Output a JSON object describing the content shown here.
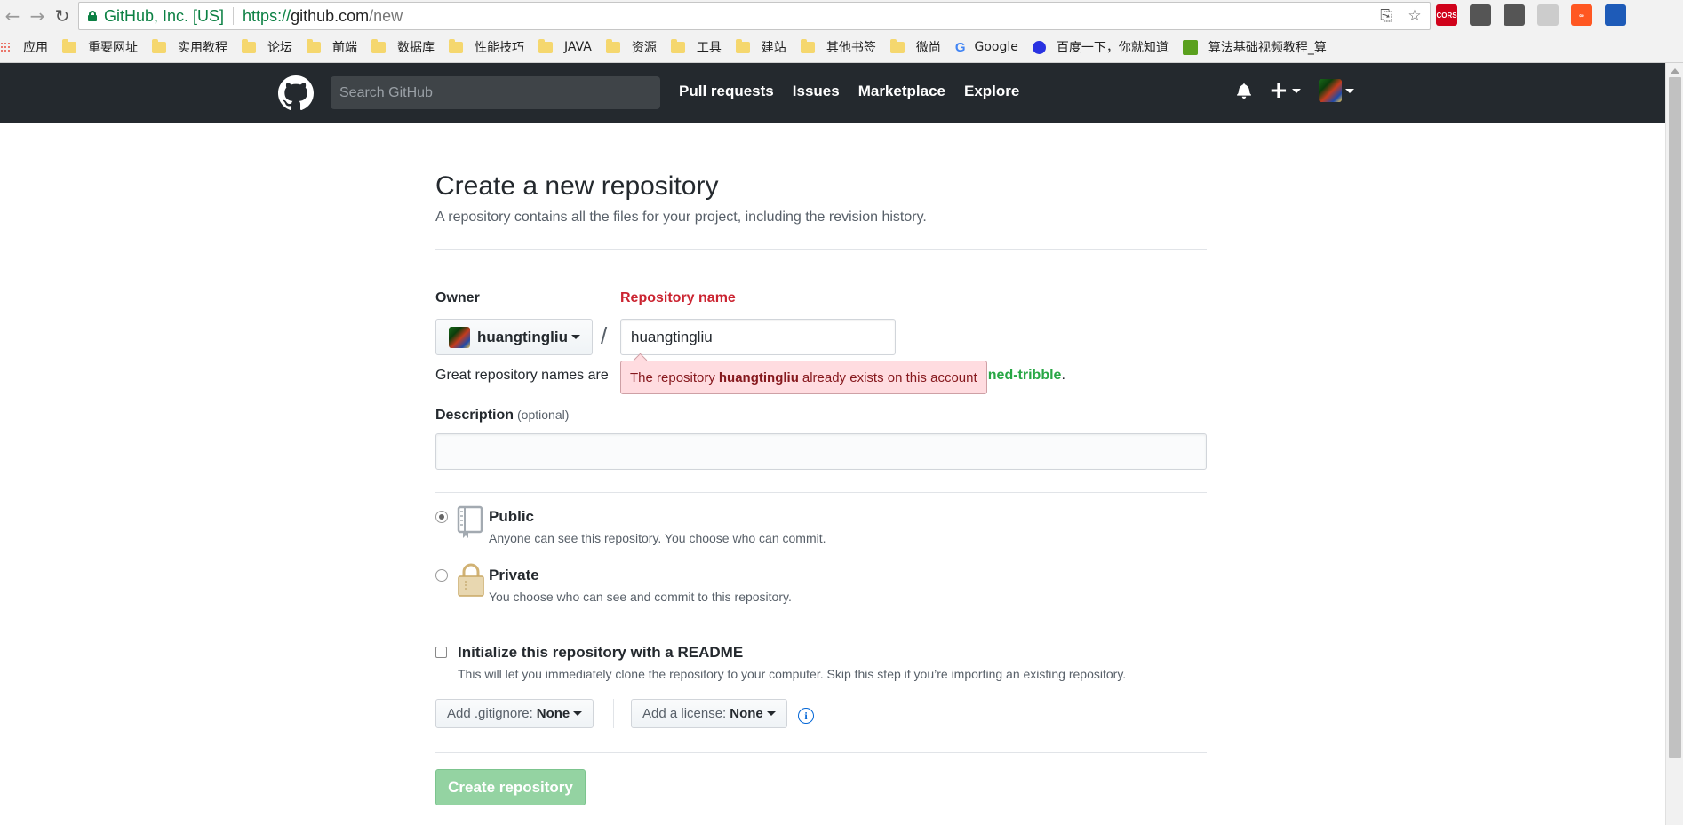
{
  "browser": {
    "site_identity": "GitHub, Inc. [US]",
    "url_secure": "https://",
    "url_host": "github.com",
    "url_path": "/new",
    "bookmarks": [
      "应用",
      "重要网址",
      "实用教程",
      "论坛",
      "前端",
      "数据库",
      "性能技巧",
      "JAVA",
      "资源",
      "工具",
      "建站",
      "其他书签",
      "微尚",
      "Google",
      "百度一下，你就知道",
      "算法基础视频教程_算"
    ],
    "extensions": [
      {
        "name": "cors-icon",
        "label": "CORS",
        "color": "#d0021b"
      },
      {
        "name": "evernote-icon",
        "label": "",
        "color": "#555555"
      },
      {
        "name": "translate-icon",
        "label": "",
        "color": "#555555"
      },
      {
        "name": "shield-icon",
        "label": "",
        "color": "#cccccc"
      },
      {
        "name": "infinity-icon",
        "label": "∞",
        "color": "#ff5722"
      },
      {
        "name": "calendar-icon",
        "label": "",
        "color": "#1e5bb8"
      }
    ]
  },
  "github": {
    "search_placeholder": "Search GitHub",
    "nav": [
      "Pull requests",
      "Issues",
      "Marketplace",
      "Explore"
    ]
  },
  "form": {
    "title": "Create a new repository",
    "subtitle": "A repository contains all the files for your project, including the revision history.",
    "owner_label": "Owner",
    "owner_name": "huangtingliu",
    "repo_label": "Repository name",
    "repo_value": "huangtingliu",
    "slash": "/",
    "hint_prefix": "Great repository names are",
    "hint_suggestion": "esigned-tribble",
    "hint_suffix": ".",
    "error_prefix": "The repository",
    "error_repo": "huangtingliu",
    "error_suffix": "already exists on this account",
    "desc_label": "Description",
    "desc_optional": "(optional)",
    "desc_value": "",
    "public_title": "Public",
    "public_desc": "Anyone can see this repository. You choose who can commit.",
    "private_title": "Private",
    "private_desc": "You choose who can see and commit to this repository.",
    "readme_title": "Initialize this repository with a README",
    "readme_desc": "This will let you immediately clone the repository to your computer. Skip this step if you’re importing an existing repository.",
    "gitignore_label": "Add .gitignore:",
    "gitignore_value": "None",
    "license_label": "Add a license:",
    "license_value": "None",
    "create_label": "Create repository"
  }
}
